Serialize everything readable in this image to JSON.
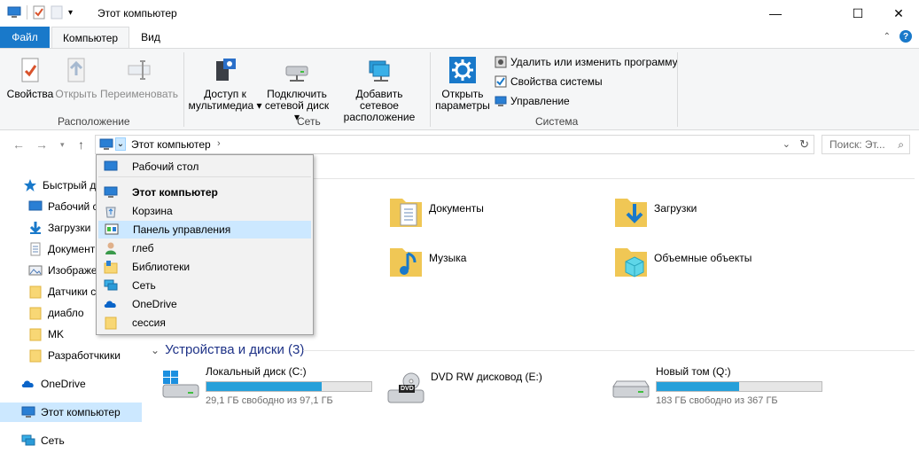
{
  "window": {
    "title": "Этот компьютер"
  },
  "titlebar": {
    "minimize": "—",
    "maximize": "☐",
    "close": "✕"
  },
  "ribbon_tabs": {
    "file": "Файл",
    "computer": "Компьютер",
    "view": "Вид"
  },
  "ribbon": {
    "properties": "Свойства",
    "open": "Открыть",
    "rename": "Переименовать",
    "location_group": "Расположение",
    "media_access_1": "Доступ к",
    "media_access_2": "мультимедиа",
    "map_drive_1": "Подключить",
    "map_drive_2": "сетевой диск",
    "add_location_1": "Добавить сетевое",
    "add_location_2": "расположение",
    "network_group": "Сеть",
    "open_settings_1": "Открыть",
    "open_settings_2": "параметры",
    "uninstall": "Удалить или изменить программу",
    "system_props": "Свойства системы",
    "manage": "Управление",
    "system_group": "Система"
  },
  "address": {
    "location": "Этот компьютер",
    "search_placeholder": "Поиск: Эт..."
  },
  "nav": [
    {
      "label": "Быстрый до"
    },
    {
      "label": "Рабочий с"
    },
    {
      "label": "Загрузки"
    },
    {
      "label": "Документ"
    },
    {
      "label": "Изображе"
    },
    {
      "label": "Датчики с"
    },
    {
      "label": "диабло"
    },
    {
      "label": "MK"
    },
    {
      "label": "Разработчкики"
    },
    {
      "label": "OneDrive"
    },
    {
      "label": "Этот компьютер"
    },
    {
      "label": "Сеть"
    }
  ],
  "folders": [
    {
      "label": "Документы"
    },
    {
      "label": "Загрузки"
    },
    {
      "label": "Музыка"
    },
    {
      "label": "Объемные объекты"
    }
  ],
  "devices_header": "Устройства и диски (3)",
  "drives": [
    {
      "name": "Локальный диск (C:)",
      "free": "29,1 ГБ свободно из 97,1 ГБ",
      "used_fraction": 0.7
    },
    {
      "name": "DVD RW дисковод (E:)",
      "badge": "DVD"
    },
    {
      "name": "Новый том (Q:)",
      "free": "183 ГБ свободно из 367 ГБ",
      "used_fraction": 0.5
    }
  ],
  "dropdown": [
    {
      "label": "Рабочий стол"
    },
    {
      "label": "Этот компьютер"
    },
    {
      "label": "Корзина"
    },
    {
      "label": "Панель управления"
    },
    {
      "label": "глеб"
    },
    {
      "label": "Библиотеки"
    },
    {
      "label": "Сеть"
    },
    {
      "label": "OneDrive"
    },
    {
      "label": "сессия"
    }
  ]
}
